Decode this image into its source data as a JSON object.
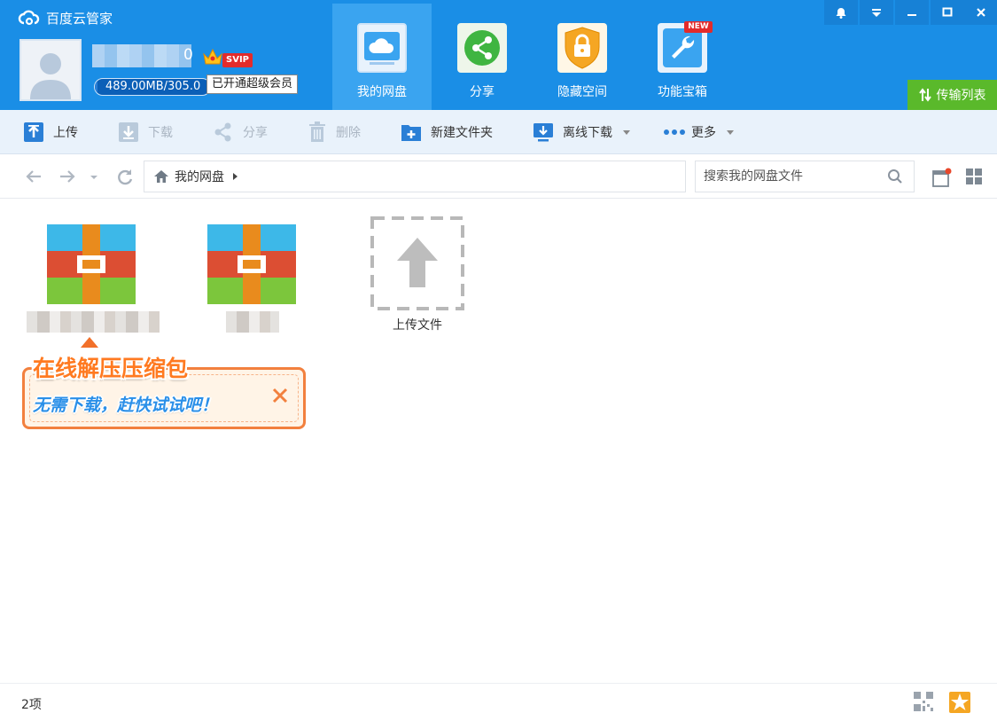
{
  "app": {
    "title": "百度云管家"
  },
  "account": {
    "name_suffix": "0",
    "vip_badge": "SVIP",
    "quota_text": "489.00MB/305.0",
    "quota_fraction": 0.02,
    "vip_tooltip": "已开通超级会员"
  },
  "nav": {
    "tabs": [
      {
        "label": "我的网盘",
        "icon": "cloud-drive-icon"
      },
      {
        "label": "分享",
        "icon": "share-icon"
      },
      {
        "label": "隐藏空间",
        "icon": "lock-shield-icon"
      },
      {
        "label": "功能宝箱",
        "icon": "wrench-icon"
      }
    ],
    "new_badge": "NEW"
  },
  "window_controls": [
    "bell-icon",
    "menu-icon",
    "minimize-icon",
    "maximize-icon",
    "close-icon"
  ],
  "transfer_list": {
    "label": "传输列表"
  },
  "toolbar": {
    "upload": "上传",
    "download": "下载",
    "share": "分享",
    "delete": "删除",
    "new_folder": "新建文件夹",
    "offline_download": "离线下载",
    "more": "更多"
  },
  "address": {
    "breadcrumb_root": "我的网盘",
    "search_placeholder": "搜索我的网盘文件"
  },
  "files": {
    "items": [
      {
        "type": "archive",
        "icon": "rar-archive-icon"
      },
      {
        "type": "archive",
        "icon": "rar-archive-icon"
      }
    ],
    "upload_tile_label": "上传文件"
  },
  "promo": {
    "title": "在线解压压缩包",
    "subtitle": "无需下载，赶快试试吧！"
  },
  "status": {
    "item_count": "2项"
  },
  "colors": {
    "header_blue": "#1a8ee6",
    "active_tab": "#3aa4f0",
    "toolbar_bg": "#e9f2fb",
    "transfer_green": "#5ab92b",
    "promo_orange": "#f2803e"
  }
}
